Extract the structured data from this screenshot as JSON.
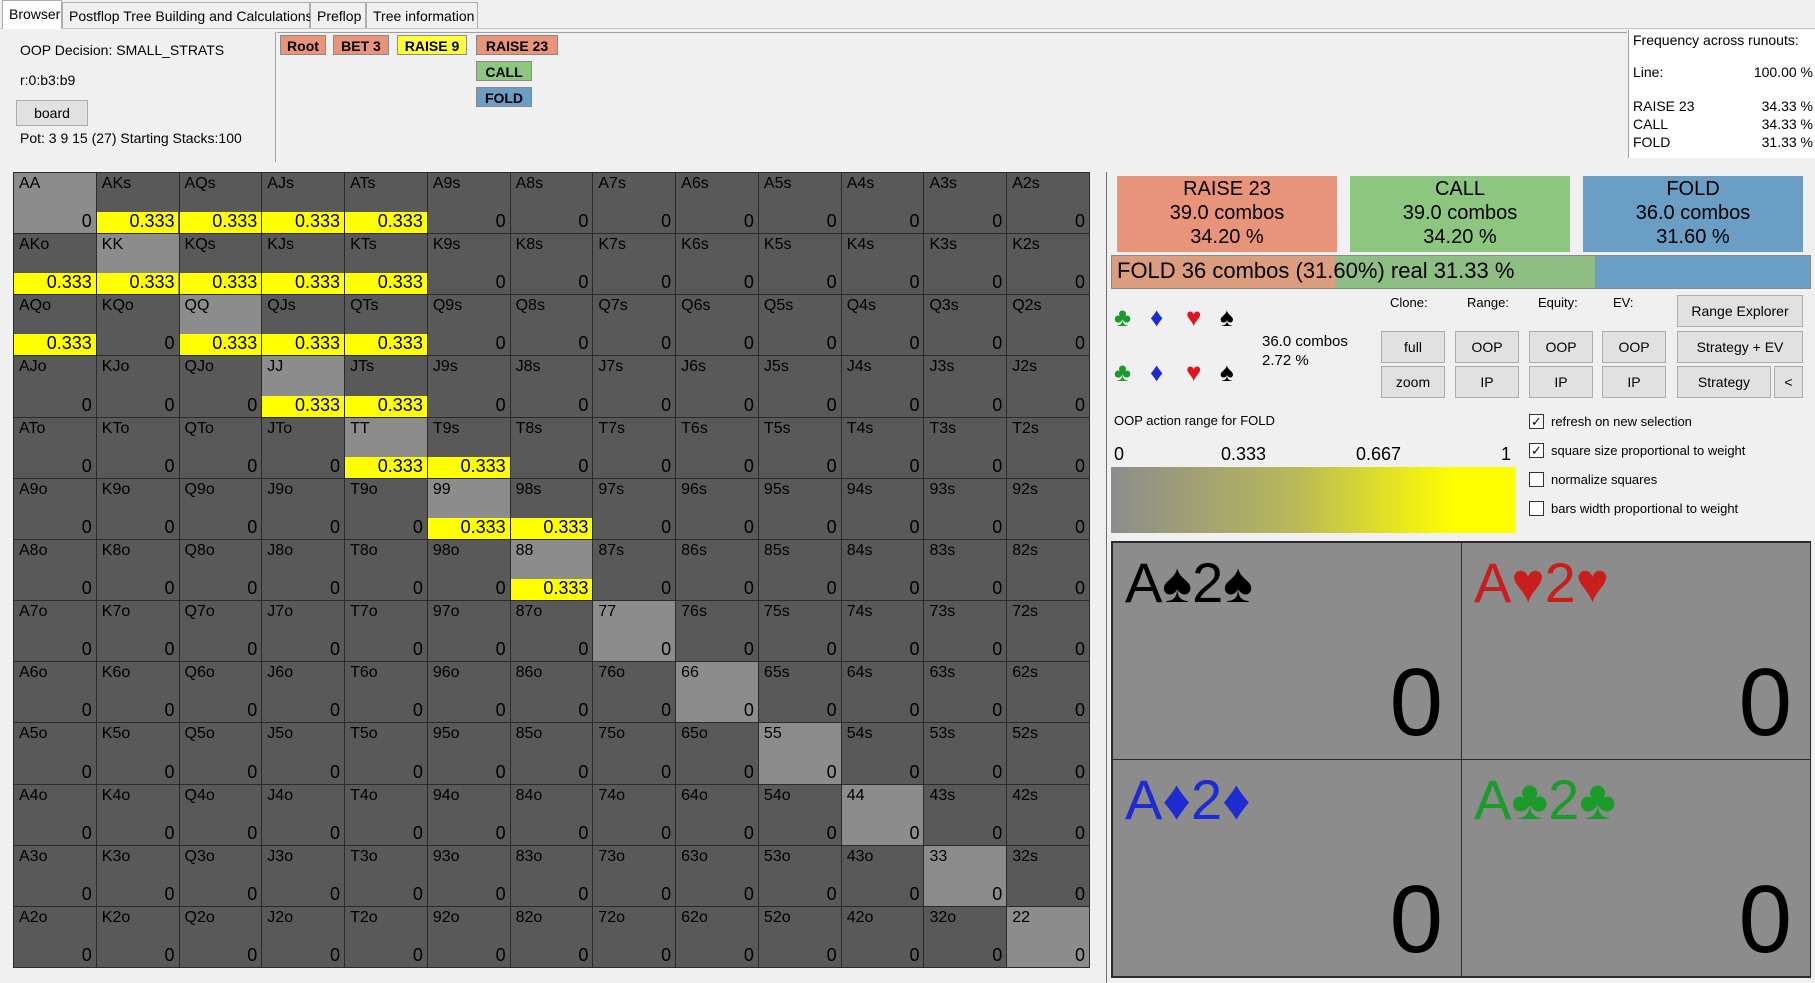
{
  "tabs": [
    "Browser",
    "Postflop Tree Building and Calculations",
    "Preflop",
    "Tree information"
  ],
  "info": {
    "decision_label": "OOP Decision:",
    "decision_value": "SMALL_STRATS",
    "line_code": "r:0:b3:b9",
    "board_button": "board",
    "pot": "Pot: 3 9 15 (27) Starting Stacks:100"
  },
  "tree": {
    "nodes": [
      {
        "label": "Root",
        "color": "#e8947a"
      },
      {
        "label": "BET 3",
        "color": "#e8947a"
      },
      {
        "label": "RAISE 9",
        "color": "#ffff3c"
      },
      {
        "label": "RAISE 23",
        "color": "#e8947a"
      },
      {
        "label": "CALL",
        "color": "#8cc67f"
      },
      {
        "label": "FOLD",
        "color": "#6a9ec4"
      }
    ]
  },
  "frequency": {
    "title": "Frequency across runouts:",
    "line_label": "Line:",
    "line_value": "100.00 %",
    "rows": [
      {
        "label": "RAISE 23",
        "value": "34.33 %"
      },
      {
        "label": "CALL",
        "value": "34.33 %"
      },
      {
        "label": "FOLD",
        "value": "31.33 %"
      }
    ]
  },
  "grid": {
    "ranks": [
      "A",
      "K",
      "Q",
      "J",
      "T",
      "9",
      "8",
      "7",
      "6",
      "5",
      "4",
      "3",
      "2"
    ],
    "colors": {
      "cell": "#595959",
      "pair": "#8c8c8c",
      "bar": "#ffff00"
    },
    "highlighted": {
      "AKs": "0.333",
      "AQs": "0.333",
      "AJs": "0.333",
      "ATs": "0.333",
      "AKo": "0.333",
      "KK": "0.333",
      "KQs": "0.333",
      "KJs": "0.333",
      "KTs": "0.333",
      "AQo": "0.333",
      "QQ": "0.333",
      "QJs": "0.333",
      "QTs": "0.333",
      "JJ": "0.333",
      "JTs": "0.333",
      "TT": "0.333",
      "T9s": "0.333",
      "99": "0.333",
      "98s": "0.333",
      "88": "0.333"
    },
    "default_value": "0"
  },
  "actions": [
    {
      "name": "RAISE 23",
      "combos": "39.0 combos",
      "pct": "34.20 %",
      "color": "#e8947a"
    },
    {
      "name": "CALL",
      "combos": "39.0 combos",
      "pct": "34.20 %",
      "color": "#8cc67f"
    },
    {
      "name": "FOLD",
      "combos": "36.0 combos",
      "pct": "31.60 %",
      "color": "#6a9ec4"
    }
  ],
  "fold_summary": "FOLD  36 combos (31.60%) real  31.33 %",
  "suits": {
    "row1": [
      "♣",
      "♦",
      "♥",
      "♠"
    ],
    "row2": [
      "♣",
      "♦",
      "♥",
      "♠"
    ],
    "colors": [
      "#1a9b2a",
      "#1d2bd0",
      "#e0141e",
      "#000000"
    ]
  },
  "combo_stats": {
    "combos": "36.0 combos",
    "pct": "2.72 %"
  },
  "controls": {
    "clone_label": "Clone:",
    "range_label": "Range:",
    "equity_label": "Equity:",
    "ev_label": "EV:",
    "full": "full",
    "zoom": "zoom",
    "oop": "OOP",
    "ip": "IP",
    "range_explorer": "Range Explorer",
    "strategy_ev": "Strategy + EV",
    "strategy": "Strategy",
    "collapse": "<"
  },
  "range_title": "OOP action range for FOLD",
  "gradient_labels": [
    "0",
    "0.333",
    "0.667",
    "1"
  ],
  "checkboxes": [
    {
      "label": "refresh on new selection",
      "checked": true
    },
    {
      "label": "square size proportional to weight",
      "checked": true
    },
    {
      "label": "normalize squares",
      "checked": false
    },
    {
      "label": "bars width proportional to weight",
      "checked": false
    }
  ],
  "combos_detail": [
    {
      "card1": "A",
      "suit1": "♠",
      "card2": "2",
      "suit2": "♠",
      "value": "0",
      "color": "#000000"
    },
    {
      "card1": "A",
      "suit1": "♥",
      "card2": "2",
      "suit2": "♥",
      "value": "0",
      "color": "#c81e1e"
    },
    {
      "card1": "A",
      "suit1": "♦",
      "card2": "2",
      "suit2": "♦",
      "value": "0",
      "color": "#1d2bd0"
    },
    {
      "card1": "A",
      "suit1": "♣",
      "card2": "2",
      "suit2": "♣",
      "value": "0",
      "color": "#1a9b2a"
    }
  ]
}
